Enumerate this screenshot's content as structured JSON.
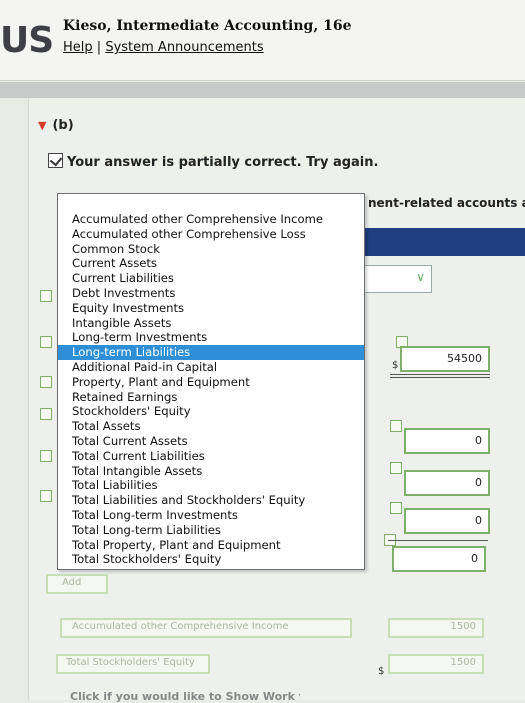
{
  "header": {
    "logo_text": "US",
    "book_title": "Kieso, Intermediate Accounting, 16e",
    "help_link": "Help",
    "separator": "|",
    "announcements_link": "System Announcements"
  },
  "part": {
    "label": "(b)"
  },
  "feedback": {
    "text": "Your answer is partially correct.  Try again."
  },
  "right_label": "nent-related accounts at",
  "dropdown": {
    "options": [
      "Accumulated other Comprehensive Income",
      "Accumulated other Comprehensive Loss",
      "Common Stock",
      "Current Assets",
      "Current Liabilities",
      "Debt Investments",
      "Equity Investments",
      "Intangible Assets",
      "Long-term Investments",
      "Long-term Liabilities",
      "Additional Paid-in Capital",
      "Property, Plant and Equipment",
      "Retained Earnings",
      "Stockholders' Equity",
      "Total Assets",
      "Total Current Assets",
      "Total Current Liabilities",
      "Total Intangible Assets",
      "Total Liabilities",
      "Total Liabilities and Stockholders' Equity",
      "Total Long-term Investments",
      "Total Long-term Liabilities",
      "Total Property, Plant and Equipment",
      "Total Stockholders' Equity"
    ],
    "selected_index": 9
  },
  "amounts": {
    "dollar": "$",
    "v1": "54500",
    "v2": "0",
    "v3": "0",
    "v4": "0",
    "v5": "0",
    "v6": "1500",
    "v7": "1500"
  },
  "bottom": {
    "add_button": "Add",
    "row_aoci": "Accumulated other Comprehensive Income",
    "row_tse": "Total Stockholders' Equity",
    "hint": "Click if you would like to Show Work for this question"
  },
  "colors": {
    "accent_green": "#7fb069",
    "select_blue": "#2f8fd6",
    "band_navy": "#1f3f82"
  }
}
